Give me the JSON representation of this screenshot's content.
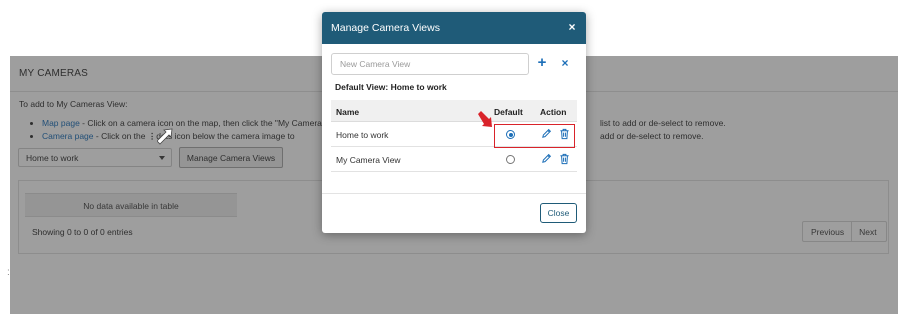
{
  "page": {
    "title": "MY CAMERAS",
    "intro": "To add to My Cameras View:",
    "bullets": [
      {
        "link": "Map page",
        "text": " - Click on a camera icon on the map, then click the \"My Cameras",
        "tail": "list to add or de-select to remove."
      },
      {
        "link": "Camera page",
        "text_before": " - Click on the ",
        "text_after": " dots icon below the camera image to",
        "tail": "add or de-select to remove."
      }
    ],
    "view_select": "Home to work",
    "manage_button": "Manage Camera Views",
    "table": {
      "empty_message": "No data available in table",
      "entries_info": "Showing 0 to 0 of 0 entries",
      "previous": "Previous",
      "next": "Next"
    }
  },
  "modal": {
    "title": "Manage Camera Views",
    "close_symbol": "×",
    "input_placeholder": "New Camera View",
    "add_symbol": "+",
    "clear_symbol": "×",
    "default_view_label": "Default View: Home to work",
    "columns": {
      "name": "Name",
      "default": "Default",
      "action": "Action"
    },
    "rows": [
      {
        "name": "Home to work",
        "is_default": true
      },
      {
        "name": "My Camera View",
        "is_default": false
      }
    ],
    "close_button": "Close"
  },
  "icons": {
    "edit": "pencil-icon",
    "delete": "trash-icon",
    "dots": "vertical-dots-icon",
    "annotation_white": "white-arrow-icon",
    "annotation_red": "red-arrow-icon"
  },
  "colors": {
    "modal_header": "#1f5b78",
    "link": "#1d6fb8",
    "highlight": "#d9232a",
    "overlay": "rgba(40,40,40,0.45)"
  }
}
